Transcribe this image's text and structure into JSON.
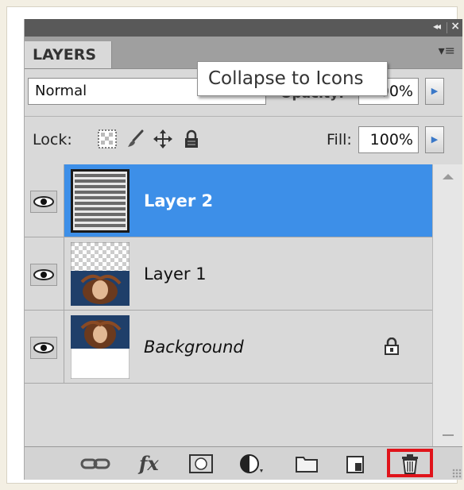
{
  "panel": {
    "tab_label": "LAYERS",
    "collapse_glyph": "◂◂",
    "close_glyph": "×",
    "menu_glyph": "▾≡",
    "tooltip": "Collapse to Icons"
  },
  "blend": {
    "mode": "Normal",
    "opacity_label": "Opacity:",
    "opacity_value": "100%"
  },
  "lock": {
    "label": "Lock:",
    "icons": [
      "lock-transparent-pixels-icon",
      "lock-image-pixels-icon",
      "lock-position-icon",
      "lock-all-icon"
    ],
    "fill_label": "Fill:",
    "fill_value": "100%"
  },
  "layers": [
    {
      "name": "Layer 2",
      "selected": true,
      "italic": false,
      "visible": true
    },
    {
      "name": "Layer 1",
      "selected": false,
      "italic": false,
      "visible": true
    },
    {
      "name": "Background",
      "selected": false,
      "italic": true,
      "visible": true,
      "locked": true
    }
  ],
  "bottom_toolbar": {
    "buttons": [
      "link-layers-icon",
      "fx-layer-style-icon",
      "add-mask-icon",
      "adjustment-layer-icon",
      "group-folder-icon",
      "new-layer-icon",
      "delete-layer-icon"
    ],
    "fx_label": "fx",
    "highlighted": "delete-layer-icon",
    "highlight_color": "#e0141b"
  },
  "colors": {
    "selection": "#3d8fe8",
    "panel_bg": "#d9d9d9"
  }
}
